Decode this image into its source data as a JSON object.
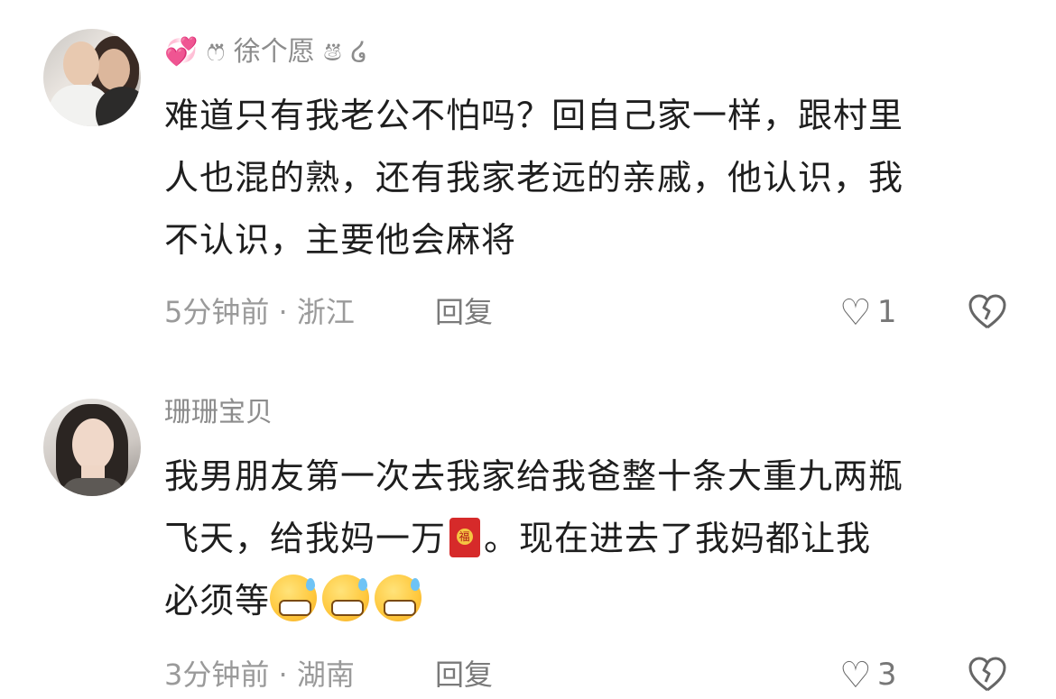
{
  "comments": [
    {
      "username": "💞 ෆ⃛ 徐个愿 ෂ⃛ ໒",
      "lines": [
        "难道只有我老公不怕吗？回自己家一样，跟村里",
        "人也混的熟，还有我家老远的亲戚，他认识，我",
        "不认识，主要他会麻将"
      ],
      "time_location": "5分钟前 · 浙江",
      "reply_label": "回复",
      "likes": "1"
    },
    {
      "username": "珊珊宝贝",
      "lines": [
        "我男朋友第一次去我家给我爸整十条大重九两瓶",
        "飞天，给我妈一万",
        "。现在进去了我妈都让我",
        "必须等"
      ],
      "time_location": "3分钟前 · 湖南",
      "reply_label": "回复",
      "likes": "3"
    }
  ],
  "icons": {
    "like": "heart-outline-icon",
    "dislike": "broken-heart-icon",
    "emoji1": "red-envelope-emoji",
    "emoji2": "sweat-grin-emoji"
  }
}
